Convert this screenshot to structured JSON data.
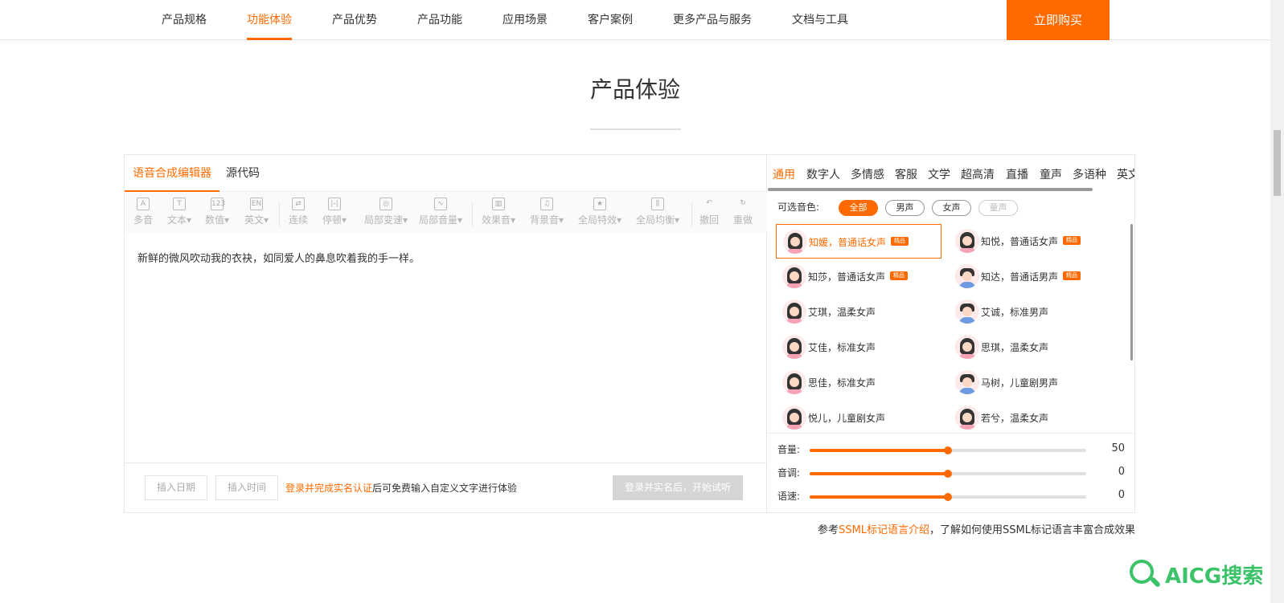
{
  "nav": {
    "items": [
      "产品规格",
      "功能体验",
      "产品优势",
      "产品功能",
      "应用场景",
      "客户案例",
      "更多产品与服务",
      "文档与工具"
    ],
    "active_index": 1,
    "buy_label": "立即购买"
  },
  "page": {
    "title": "产品体验"
  },
  "editor": {
    "tabs": [
      "语音合成编辑器",
      "源代码"
    ],
    "active_tab": 0,
    "toolbar": [
      {
        "label": "多音",
        "icon": "A"
      },
      {
        "label": "文本▾",
        "icon": "T"
      },
      {
        "label": "数值▾",
        "icon": "123"
      },
      {
        "label": "英文▾",
        "icon": "EN"
      },
      {
        "label": "连续",
        "icon": "⇄"
      },
      {
        "label": "停顿▾",
        "icon": "|-|"
      },
      {
        "label": "局部变速▾",
        "icon": "◎"
      },
      {
        "label": "局部音量▾",
        "icon": "∿"
      },
      {
        "label": "效果音▾",
        "icon": "▥"
      },
      {
        "label": "背景音▾",
        "icon": "♫"
      },
      {
        "label": "全局特效▾",
        "icon": "★"
      },
      {
        "label": "全局均衡▾",
        "icon": "⫼"
      },
      {
        "label": "撤回",
        "icon": "↶"
      },
      {
        "label": "重做",
        "icon": "↻"
      }
    ],
    "content": "新鲜的微风吹动我的衣袂，如同爱人的鼻息吹着我的手一样。",
    "footer": {
      "insert_date": "插入日期",
      "insert_time": "插入时间",
      "note_link": "登录并完成实名认证",
      "note_text": "后可免费输入自定义文字进行体验",
      "start_button": "登录并实名后，开始试听"
    }
  },
  "voices": {
    "tabs": [
      "通用",
      "数字人",
      "多情感",
      "客服",
      "文学",
      "超高清",
      "直播",
      "童声",
      "多语种",
      "英文"
    ],
    "active_tab": 0,
    "filter_label": "可选音色:",
    "filters": [
      {
        "label": "全部",
        "state": "active"
      },
      {
        "label": "男声",
        "state": "normal"
      },
      {
        "label": "女声",
        "state": "normal"
      },
      {
        "label": "童声",
        "state": "disabled"
      }
    ],
    "list": [
      {
        "name": "知媛，普通话女声",
        "badge": "精品",
        "gender": "female",
        "selected": true
      },
      {
        "name": "知悦，普通话女声",
        "badge": "精品",
        "gender": "female",
        "selected": false
      },
      {
        "name": "知莎，普通话女声",
        "badge": "精品",
        "gender": "female",
        "selected": false
      },
      {
        "name": "知达，普通话男声",
        "badge": "精品",
        "gender": "male",
        "selected": false
      },
      {
        "name": "艾琪，温柔女声",
        "badge": "",
        "gender": "female",
        "selected": false
      },
      {
        "name": "艾诚，标准男声",
        "badge": "",
        "gender": "male",
        "selected": false
      },
      {
        "name": "艾佳，标准女声",
        "badge": "",
        "gender": "female",
        "selected": false
      },
      {
        "name": "思琪，温柔女声",
        "badge": "",
        "gender": "female",
        "selected": false
      },
      {
        "name": "思佳，标准女声",
        "badge": "",
        "gender": "female",
        "selected": false
      },
      {
        "name": "马树，儿童剧男声",
        "badge": "",
        "gender": "male",
        "selected": false
      },
      {
        "name": "悦儿，儿童剧女声",
        "badge": "",
        "gender": "female",
        "selected": false
      },
      {
        "name": "若兮，温柔女声",
        "badge": "",
        "gender": "female",
        "selected": false
      }
    ],
    "sliders": [
      {
        "label": "音量:",
        "value": "50",
        "fraction": 0.5
      },
      {
        "label": "音调:",
        "value": "0",
        "fraction": 0.5
      },
      {
        "label": "语速:",
        "value": "0",
        "fraction": 0.5
      }
    ]
  },
  "ssml_note": {
    "prefix": "参考",
    "link": "SSML标记语言介绍",
    "suffix": "，了解如何使用SSML标记语言丰富合成效果"
  },
  "watermark": {
    "text": "AICG搜索"
  },
  "colors": {
    "accent": "#ff6a00",
    "watermark": "#3cc36a"
  }
}
